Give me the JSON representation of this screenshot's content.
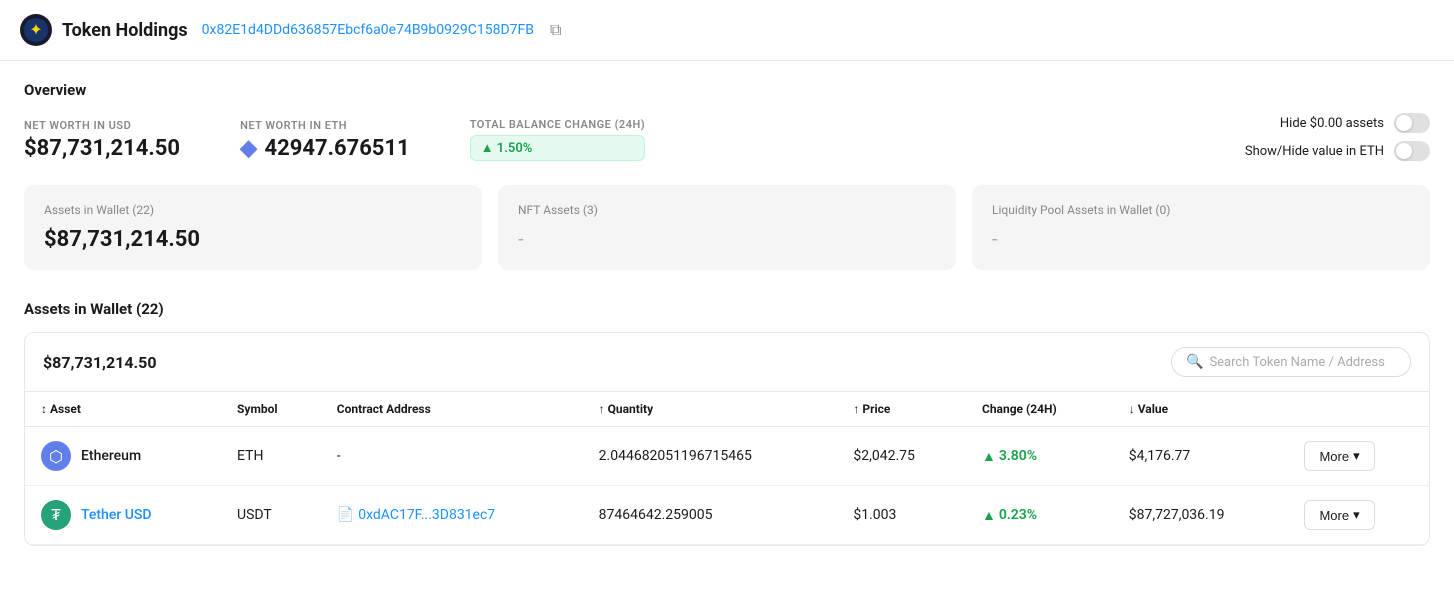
{
  "header": {
    "app_title": "Token Holdings",
    "wallet_address": "0x82E1d4DDd636857Ebcf6a0e74B9b0929C158D7FB",
    "copy_tooltip": "Copy address"
  },
  "overview": {
    "section_title": "Overview",
    "metrics": [
      {
        "label": "NET WORTH IN USD",
        "value": "$87,731,214.50"
      },
      {
        "label": "NET WORTH IN ETH",
        "value": "42947.676511"
      },
      {
        "label": "TOTAL BALANCE CHANGE (24H)",
        "value": "▲ 1.50%"
      }
    ],
    "toggles": [
      {
        "label": "Hide $0.00 assets"
      },
      {
        "label": "Show/Hide value in ETH"
      }
    ]
  },
  "cards": [
    {
      "label": "Assets in Wallet (22)",
      "value": "$87,731,214.50"
    },
    {
      "label": "NFT Assets (3)",
      "value": "-"
    },
    {
      "label": "Liquidity Pool Assets in Wallet (0)",
      "value": "-"
    }
  ],
  "assets_table": {
    "section_title": "Assets in Wallet (22)",
    "total": "$87,731,214.50",
    "search_placeholder": "Search Token Name / Address",
    "columns": [
      "Asset",
      "Symbol",
      "Contract Address",
      "Quantity",
      "Price",
      "Change (24H)",
      "Value",
      ""
    ],
    "rows": [
      {
        "asset_name": "Ethereum",
        "asset_type": "eth",
        "symbol": "ETH",
        "contract_address": "-",
        "quantity": "2.044682051196715465",
        "price": "$2,042.75",
        "change": "3.80%",
        "value": "$4,176.77"
      },
      {
        "asset_name": "Tether USD",
        "asset_type": "usdt",
        "symbol": "USDT",
        "contract_address": "0xdAC17F...3D831ec7",
        "quantity": "87464642.259005",
        "price": "$1.003",
        "change": "0.23%",
        "value": "$87,727,036.19"
      }
    ],
    "more_label": "More"
  }
}
